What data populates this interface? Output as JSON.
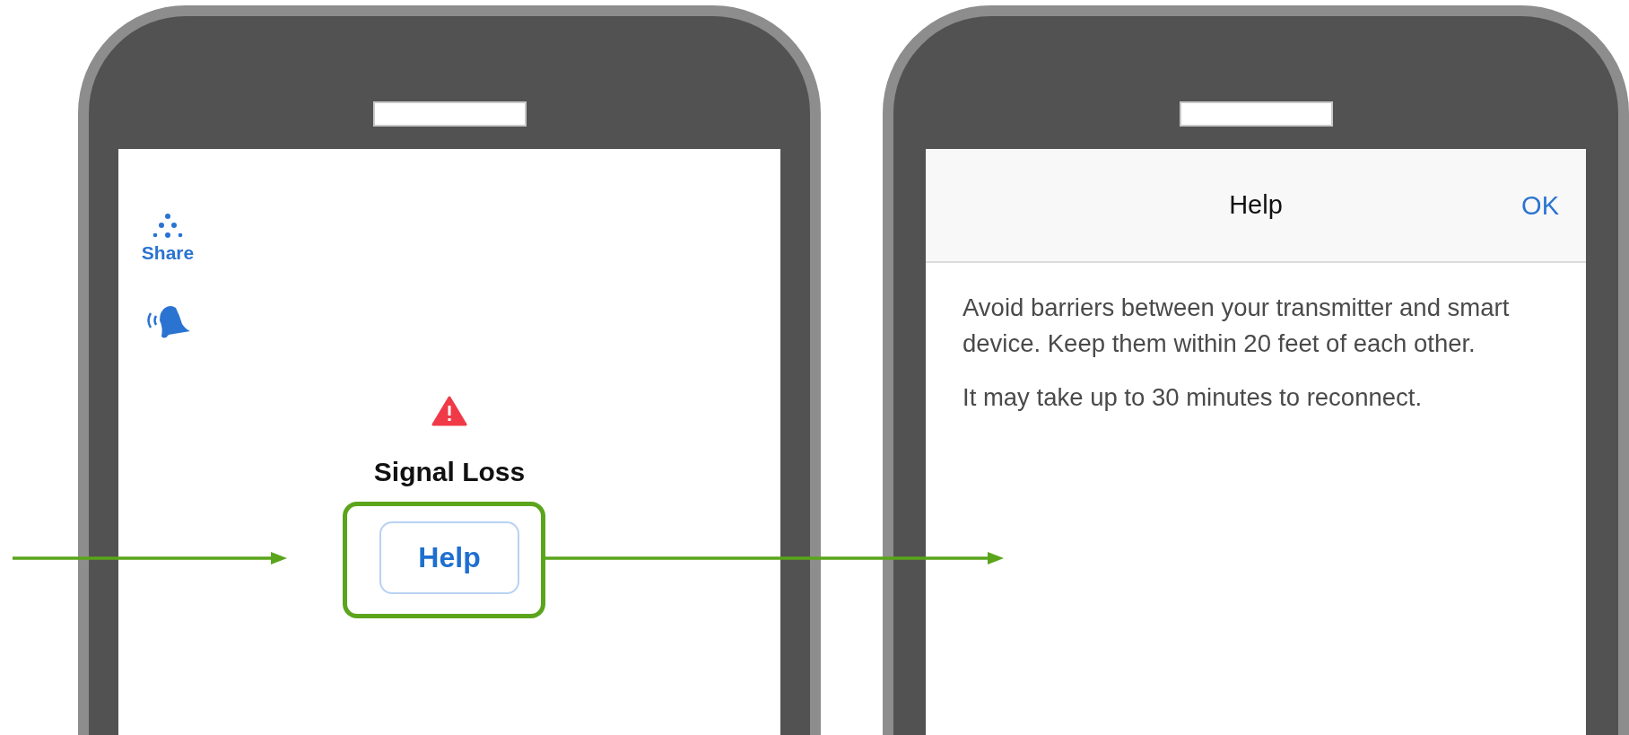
{
  "left_screen": {
    "share_label": "Share",
    "alert": {
      "title": "Signal Loss",
      "button": "Help"
    }
  },
  "right_screen": {
    "header": {
      "title": "Help",
      "action": "OK"
    },
    "paragraphs": [
      "Avoid barriers between your transmitter and smart device. Keep them within 20 feet of each other.",
      "It may take up to 30 minutes to reconnect."
    ]
  }
}
